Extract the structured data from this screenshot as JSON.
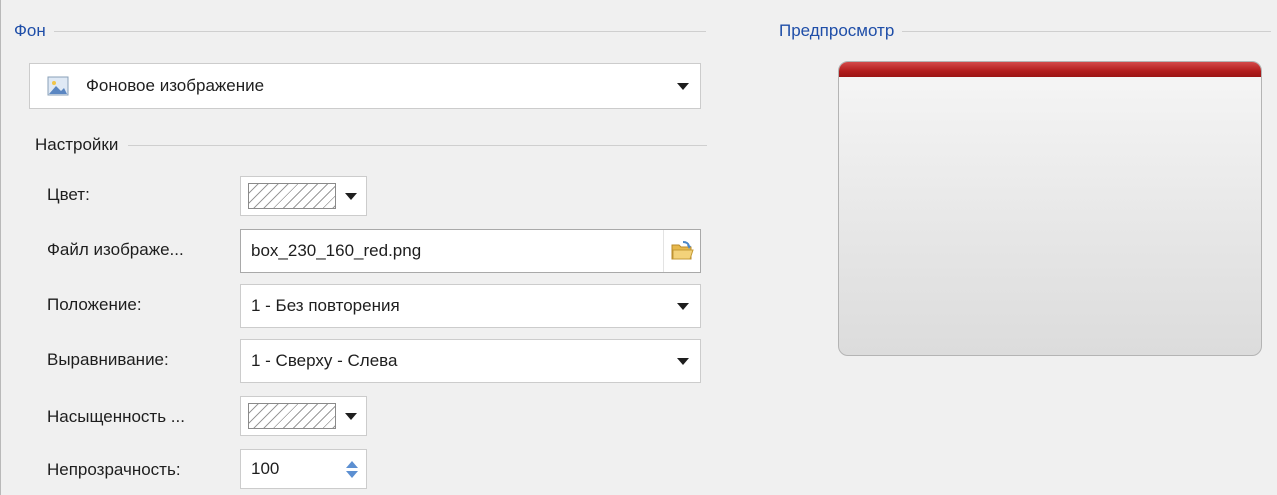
{
  "background_group": {
    "title": "Фон"
  },
  "preview_group": {
    "title": "Предпросмотр"
  },
  "background_type": {
    "icon": "image-icon",
    "value": "Фоновое изображение"
  },
  "settings": {
    "title": "Настройки",
    "color": {
      "label": "Цвет:"
    },
    "image_file": {
      "label": "Файл изображе...",
      "value": "box_230_160_red.png",
      "button_icon": "folder-open-icon"
    },
    "position": {
      "label": "Положение:",
      "value": "1 - Без повторения"
    },
    "alignment": {
      "label": "Выравнивание:",
      "value": "1 - Сверху - Слева"
    },
    "saturation": {
      "label": "Насыщенность ..."
    },
    "opacity": {
      "label": "Непрозрачность:",
      "value": "100"
    }
  },
  "colors": {
    "accent_blue": "#1f4ea8",
    "preview_top_red": "#b21d1d"
  }
}
